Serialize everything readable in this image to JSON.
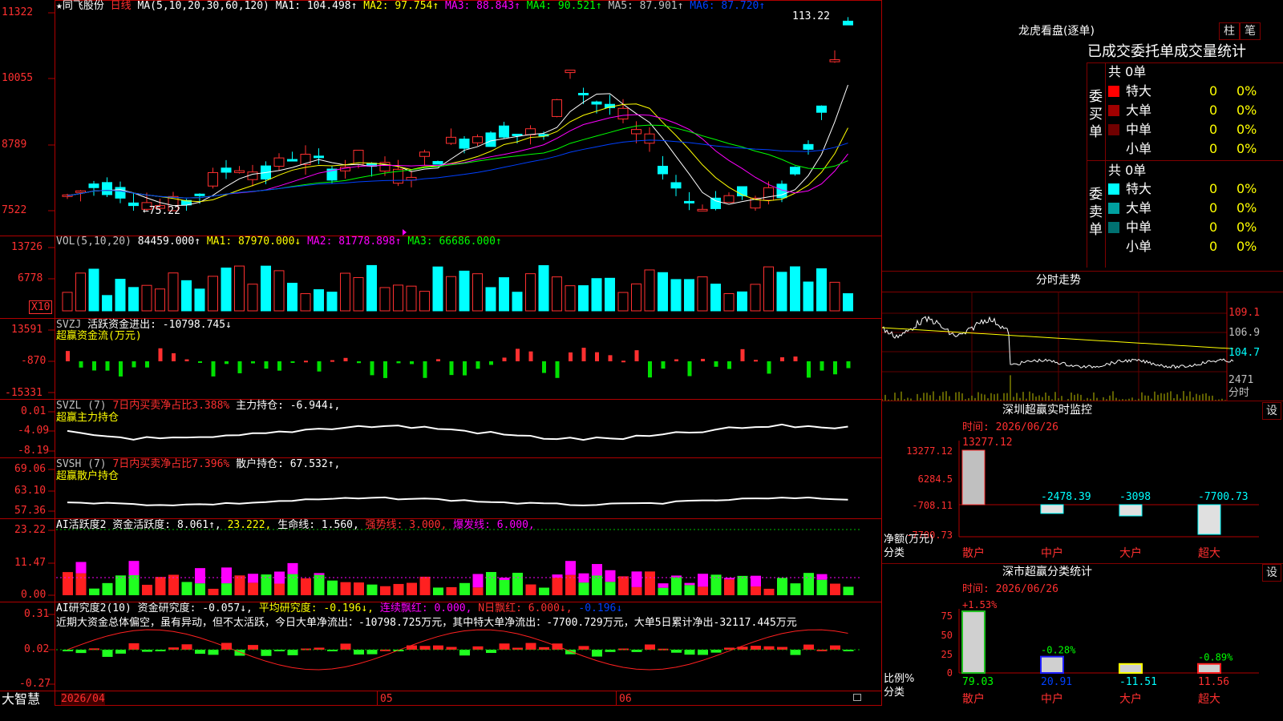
{
  "stock": {
    "star": "★",
    "name": "同飞股份",
    "period": "日线"
  },
  "ma": {
    "title": "MA(5,10,20,30,60,120)",
    "items": [
      {
        "label": "MA1: 104.498↑",
        "color": "#ffffff"
      },
      {
        "label": "MA2: 97.754↑",
        "color": "#ffff00"
      },
      {
        "label": "MA3: 88.843↑",
        "color": "#ff00ff"
      },
      {
        "label": "MA4: 90.521↑",
        "color": "#00ff00"
      },
      {
        "label": "MA5: 87.901↑",
        "color": "#c0c0c0"
      },
      {
        "label": "MA6: 87.720↑",
        "color": "#0040ff"
      }
    ]
  },
  "price_axis": [
    "11322",
    "10055",
    "8789",
    "7522"
  ],
  "price_marks": {
    "high": "113.22",
    "low": "75.22"
  },
  "vol": {
    "title": "VOL(5,10,20)",
    "value": "84459.000↑",
    "items": [
      {
        "label": "MA1: 87970.000↓",
        "color": "#ffff00"
      },
      {
        "label": "MA2: 81778.898↑",
        "color": "#ff00ff"
      },
      {
        "label": "MA3: 66686.000↑",
        "color": "#00ff00"
      }
    ],
    "axis": [
      "13726",
      "6778"
    ],
    "unit": "X10"
  },
  "svzj": {
    "title": "SVZJ",
    "label": "活跃资金进出: -10798.745↓",
    "subtitle": "超赢资金流(万元)",
    "axis": [
      "13591",
      "-870",
      "-15331"
    ]
  },
  "svzl": {
    "title": "SVZL (7)",
    "red_text": "7日内买卖净占比3.388%",
    "label": "主力持仓: -6.944↓,",
    "subtitle": "超赢主力持仓",
    "axis": [
      "0.01",
      "-4.09",
      "-8.19"
    ]
  },
  "svsh": {
    "title": "SVSH (7)",
    "red_text": "7日内买卖净占比7.396%",
    "label": "散户持仓: 67.532↑,",
    "subtitle": "超赢散户持仓",
    "axis": [
      "69.06",
      "63.10",
      "57.36"
    ]
  },
  "ai_act": {
    "title": "AI活跃度2 资金活跃度: 8.061↑,",
    "v2": "23.222,",
    "life": "生命线: 1.560,",
    "strong": "强势线: 3.000,",
    "burst": "爆发线: 6.000,",
    "axis": [
      "23.22",
      "11.47",
      "0.00"
    ]
  },
  "ai_res": {
    "title": "AI研究度2(10) 资金研究度: -0.057↓,",
    "avg": "平均研究度: -0.196↓,",
    "red": "连续飘红: 0.000,",
    "nred": "N日飘红: 6.000↓,",
    "last": "-0.196↓",
    "comment": "近期大资金总体偏空，虽有异动，但不太活跃，今日大单净流出：-10798.725万元，其中特大单净流出：-7700.729万元，大单5日累计净出-32117.445万元",
    "axis": [
      "0.31",
      "0.02",
      "-0.27"
    ]
  },
  "date_axis": {
    "left": "2026/04",
    "m5": "05",
    "m6": "06"
  },
  "brand": "大智慧",
  "right": {
    "title": "龙虎看盘(逐单)",
    "btn1": "柱",
    "btn2": "笔",
    "tabs": "已成交委托单成交量统计",
    "buy": {
      "group": "委买单",
      "total": "共 0单",
      "rows": [
        {
          "name": "特大",
          "count": "0",
          "pct": "0%",
          "color": "#ff0000"
        },
        {
          "name": "大单",
          "count": "0",
          "pct": "0%",
          "color": "#a00000"
        },
        {
          "name": "中单",
          "count": "0",
          "pct": "0%",
          "color": "#700000"
        },
        {
          "name": "小单",
          "count": "0",
          "pct": "0%",
          "color": ""
        }
      ]
    },
    "sell": {
      "group": "委卖单",
      "total": "共 0单",
      "rows": [
        {
          "name": "特大",
          "count": "0",
          "pct": "0%",
          "color": "#00ffff"
        },
        {
          "name": "大单",
          "count": "0",
          "pct": "0%",
          "color": "#00a0a0"
        },
        {
          "name": "中单",
          "count": "0",
          "pct": "0%",
          "color": "#007070"
        },
        {
          "name": "小单",
          "count": "0",
          "pct": "0%",
          "color": ""
        }
      ]
    },
    "intraday": {
      "title": "分时走势",
      "axis": [
        "109.1",
        "106.9",
        "104.7",
        "2471"
      ],
      "unit": "分时"
    },
    "monitor": {
      "title": "深圳超赢实时监控",
      "btn": "设",
      "time": "时间: 2026/06/26",
      "top": "13277.12",
      "axis": [
        "13277.12",
        "6284.5",
        "-708.11",
        "-7700.73"
      ],
      "ylabel": "净额(万元)",
      "xlabel": "分类",
      "bars": [
        {
          "cat": "散户",
          "value": "13277.12"
        },
        {
          "cat": "中户",
          "value": "-2478.39"
        },
        {
          "cat": "大户",
          "value": "-3098"
        },
        {
          "cat": "超大",
          "value": "-7700.73"
        }
      ]
    },
    "stats": {
      "title": "深市超赢分类统计",
      "btn": "设",
      "time": "时间: 2026/06/26",
      "axis": [
        "75",
        "50",
        "25",
        "0"
      ],
      "ylabel": "比例%",
      "xlabel": "分类",
      "bars": [
        {
          "cat": "散户",
          "pct": "+1.53%",
          "value": "79.03"
        },
        {
          "cat": "中户",
          "pct": "-0.28%",
          "value": "20.91"
        },
        {
          "cat": "大户",
          "pct": "",
          "value": "-11.51"
        },
        {
          "cat": "超大",
          "pct": "-0.89%",
          "value": "11.56"
        }
      ]
    }
  }
}
